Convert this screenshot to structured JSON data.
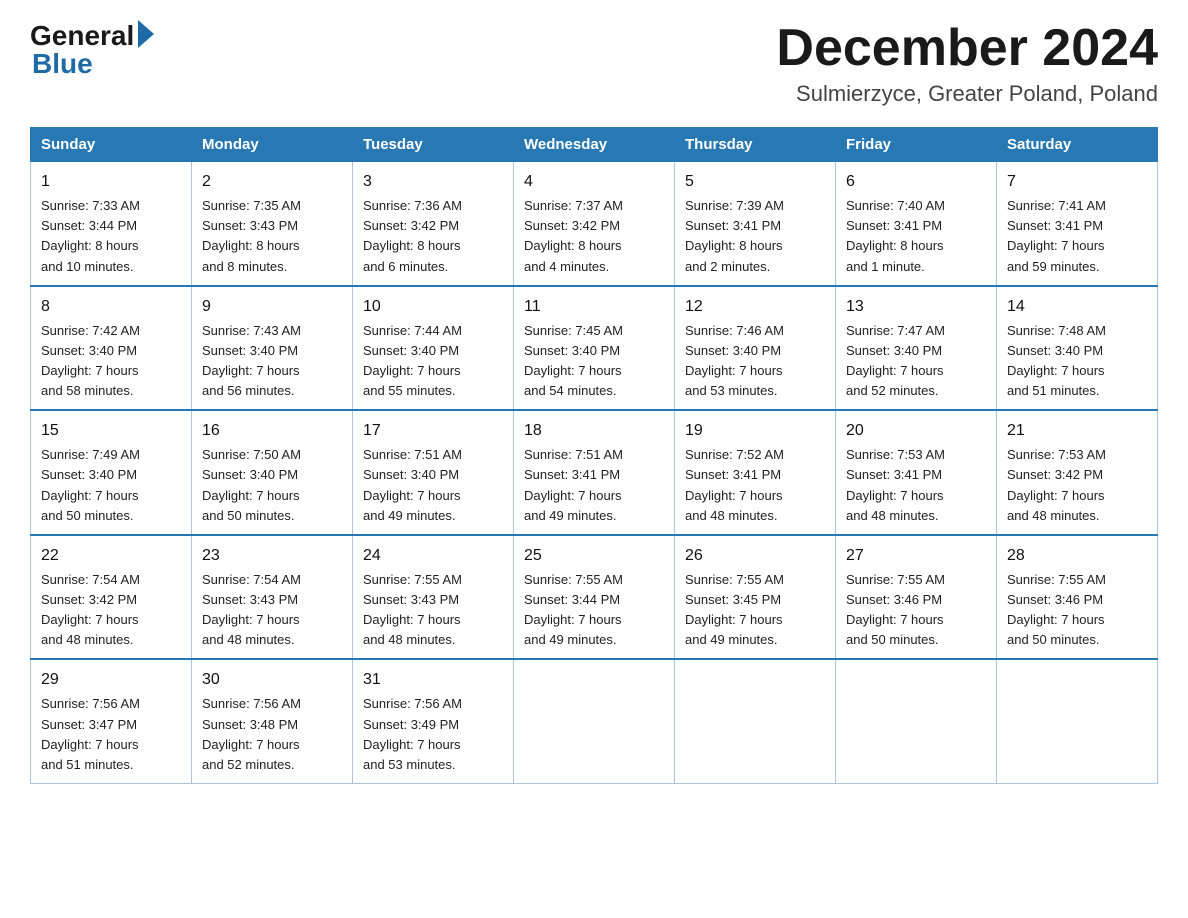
{
  "header": {
    "logo_general": "General",
    "logo_blue": "Blue",
    "month_title": "December 2024",
    "location": "Sulmierzyce, Greater Poland, Poland"
  },
  "days_of_week": [
    "Sunday",
    "Monday",
    "Tuesday",
    "Wednesday",
    "Thursday",
    "Friday",
    "Saturday"
  ],
  "weeks": [
    [
      {
        "day": "1",
        "sunrise": "7:33 AM",
        "sunset": "3:44 PM",
        "daylight": "8 hours and 10 minutes."
      },
      {
        "day": "2",
        "sunrise": "7:35 AM",
        "sunset": "3:43 PM",
        "daylight": "8 hours and 8 minutes."
      },
      {
        "day": "3",
        "sunrise": "7:36 AM",
        "sunset": "3:42 PM",
        "daylight": "8 hours and 6 minutes."
      },
      {
        "day": "4",
        "sunrise": "7:37 AM",
        "sunset": "3:42 PM",
        "daylight": "8 hours and 4 minutes."
      },
      {
        "day": "5",
        "sunrise": "7:39 AM",
        "sunset": "3:41 PM",
        "daylight": "8 hours and 2 minutes."
      },
      {
        "day": "6",
        "sunrise": "7:40 AM",
        "sunset": "3:41 PM",
        "daylight": "8 hours and 1 minute."
      },
      {
        "day": "7",
        "sunrise": "7:41 AM",
        "sunset": "3:41 PM",
        "daylight": "7 hours and 59 minutes."
      }
    ],
    [
      {
        "day": "8",
        "sunrise": "7:42 AM",
        "sunset": "3:40 PM",
        "daylight": "7 hours and 58 minutes."
      },
      {
        "day": "9",
        "sunrise": "7:43 AM",
        "sunset": "3:40 PM",
        "daylight": "7 hours and 56 minutes."
      },
      {
        "day": "10",
        "sunrise": "7:44 AM",
        "sunset": "3:40 PM",
        "daylight": "7 hours and 55 minutes."
      },
      {
        "day": "11",
        "sunrise": "7:45 AM",
        "sunset": "3:40 PM",
        "daylight": "7 hours and 54 minutes."
      },
      {
        "day": "12",
        "sunrise": "7:46 AM",
        "sunset": "3:40 PM",
        "daylight": "7 hours and 53 minutes."
      },
      {
        "day": "13",
        "sunrise": "7:47 AM",
        "sunset": "3:40 PM",
        "daylight": "7 hours and 52 minutes."
      },
      {
        "day": "14",
        "sunrise": "7:48 AM",
        "sunset": "3:40 PM",
        "daylight": "7 hours and 51 minutes."
      }
    ],
    [
      {
        "day": "15",
        "sunrise": "7:49 AM",
        "sunset": "3:40 PM",
        "daylight": "7 hours and 50 minutes."
      },
      {
        "day": "16",
        "sunrise": "7:50 AM",
        "sunset": "3:40 PM",
        "daylight": "7 hours and 50 minutes."
      },
      {
        "day": "17",
        "sunrise": "7:51 AM",
        "sunset": "3:40 PM",
        "daylight": "7 hours and 49 minutes."
      },
      {
        "day": "18",
        "sunrise": "7:51 AM",
        "sunset": "3:41 PM",
        "daylight": "7 hours and 49 minutes."
      },
      {
        "day": "19",
        "sunrise": "7:52 AM",
        "sunset": "3:41 PM",
        "daylight": "7 hours and 48 minutes."
      },
      {
        "day": "20",
        "sunrise": "7:53 AM",
        "sunset": "3:41 PM",
        "daylight": "7 hours and 48 minutes."
      },
      {
        "day": "21",
        "sunrise": "7:53 AM",
        "sunset": "3:42 PM",
        "daylight": "7 hours and 48 minutes."
      }
    ],
    [
      {
        "day": "22",
        "sunrise": "7:54 AM",
        "sunset": "3:42 PM",
        "daylight": "7 hours and 48 minutes."
      },
      {
        "day": "23",
        "sunrise": "7:54 AM",
        "sunset": "3:43 PM",
        "daylight": "7 hours and 48 minutes."
      },
      {
        "day": "24",
        "sunrise": "7:55 AM",
        "sunset": "3:43 PM",
        "daylight": "7 hours and 48 minutes."
      },
      {
        "day": "25",
        "sunrise": "7:55 AM",
        "sunset": "3:44 PM",
        "daylight": "7 hours and 49 minutes."
      },
      {
        "day": "26",
        "sunrise": "7:55 AM",
        "sunset": "3:45 PM",
        "daylight": "7 hours and 49 minutes."
      },
      {
        "day": "27",
        "sunrise": "7:55 AM",
        "sunset": "3:46 PM",
        "daylight": "7 hours and 50 minutes."
      },
      {
        "day": "28",
        "sunrise": "7:55 AM",
        "sunset": "3:46 PM",
        "daylight": "7 hours and 50 minutes."
      }
    ],
    [
      {
        "day": "29",
        "sunrise": "7:56 AM",
        "sunset": "3:47 PM",
        "daylight": "7 hours and 51 minutes."
      },
      {
        "day": "30",
        "sunrise": "7:56 AM",
        "sunset": "3:48 PM",
        "daylight": "7 hours and 52 minutes."
      },
      {
        "day": "31",
        "sunrise": "7:56 AM",
        "sunset": "3:49 PM",
        "daylight": "7 hours and 53 minutes."
      },
      null,
      null,
      null,
      null
    ]
  ],
  "labels": {
    "sunrise": "Sunrise:",
    "sunset": "Sunset:",
    "daylight": "Daylight:"
  }
}
